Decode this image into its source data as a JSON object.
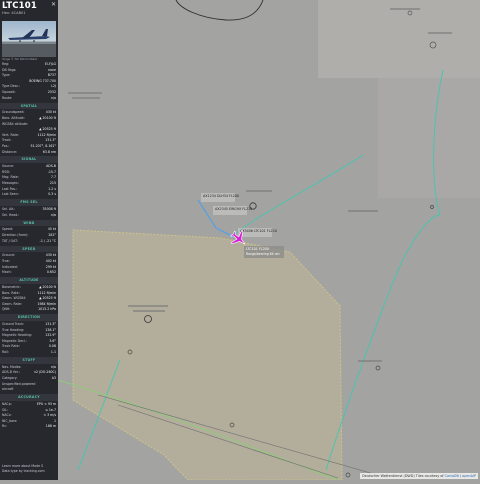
{
  "aircraft": {
    "callsign": "LTC101",
    "hex_line": "Hex: 4CAB01",
    "close": "✕",
    "photo_caption": "Image © Tim Patrick-Walsh"
  },
  "info_rows": [
    {
      "k": "Reg:",
      "v": "EI-FJLG"
    },
    {
      "k": "DB flags:",
      "v": "none"
    },
    {
      "k": "Type:",
      "v": "B737"
    },
    {
      "k": "",
      "v": "BOEING 737-700"
    },
    {
      "k": "Type Desc.:",
      "v": "L2J"
    },
    {
      "k": "Squawk:",
      "v": "2532"
    },
    {
      "k": "Route:",
      "v": "n/a"
    }
  ],
  "sections": {
    "spatial": "SPATIAL",
    "signal": "SIGNAL",
    "fms": "FMS SEL",
    "wind": "WIND",
    "speed": "SPEED",
    "altitude": "ALTITUDE",
    "direction": "DIRECTION",
    "stuff": "STUFF",
    "accuracy": "ACCURACY"
  },
  "spatial_rows": [
    {
      "k": "Groundspeed:",
      "v": "430 kt"
    },
    {
      "k": "Baro. Altitude:",
      "v": "▲ 20100 ft"
    },
    {
      "k": "WGS84 altitude:",
      "v": ""
    },
    {
      "k": "",
      "v": "▲ 20525 ft"
    },
    {
      "k": "Vert. Rate:",
      "v": "1112 ft/min"
    },
    {
      "k": "Track:",
      "v": "131.3°"
    },
    {
      "k": "Pos.:",
      "v": "51.207°, 8.161°"
    },
    {
      "k": "Distance:",
      "v": "63.8 nm"
    }
  ],
  "signal_rows": [
    {
      "k": "Source:",
      "v": "ADS-B"
    },
    {
      "k": "RSSI:",
      "v": "-15.7"
    },
    {
      "k": "Msg. Rate:",
      "v": "7.7"
    },
    {
      "k": "Messages:",
      "v": "215"
    },
    {
      "k": "Last Pos.:",
      "v": "1.2 s"
    },
    {
      "k": "Last Seen:",
      "v": "0.3 s"
    }
  ],
  "fms_rows": [
    {
      "k": "Sel. Alt.:",
      "v": "35008 ft"
    },
    {
      "k": "Sel. Head.:",
      "v": "n/a"
    }
  ],
  "wind_rows": [
    {
      "k": "Speed:",
      "v": "45 kt"
    },
    {
      "k": "Direction (from):",
      "v": "281°"
    },
    {
      "k": "TAT / OAT:",
      "v": "-1 / -21 °C"
    }
  ],
  "speed_rows": [
    {
      "k": "Ground:",
      "v": "430 kt"
    },
    {
      "k": "True:",
      "v": "402 kt"
    },
    {
      "k": "Indicated:",
      "v": "299 kt"
    },
    {
      "k": "Mach:",
      "v": "0.652"
    }
  ],
  "altitude_rows": [
    {
      "k": "Barometric:",
      "v": "▲ 20100 ft"
    },
    {
      "k": "Baro. Rate:",
      "v": "1112 ft/min"
    },
    {
      "k": "Geom. WGS84:",
      "v": "▲ 20525 ft"
    },
    {
      "k": "Geom. Rate:",
      "v": "1984 ft/min"
    },
    {
      "k": "QNH:",
      "v": "1013.2 hPa"
    }
  ],
  "direction_rows": [
    {
      "k": "Ground Track:",
      "v": "131.3°"
    },
    {
      "k": "True Heading:",
      "v": "138.1°"
    },
    {
      "k": "Magnetic Heading:",
      "v": "132.9°"
    },
    {
      "k": "Magnetic Decl.:",
      "v": "3.6°"
    },
    {
      "k": "Track Rate:",
      "v": "0.06"
    },
    {
      "k": "Roll:",
      "v": "1.1"
    }
  ],
  "stuff_rows": [
    {
      "k": "Nav. Modes:",
      "v": "n/a"
    },
    {
      "k": "ADS-B Ver.:",
      "v": "v2 (DO-260C)"
    },
    {
      "k": "Category:",
      "v": "A3"
    },
    {
      "k": "Unspecified powered",
      "v": ""
    },
    {
      "k": "aircraft",
      "v": ""
    }
  ],
  "accuracy_rows": [
    {
      "k": "NACp:",
      "v": "EPU < 93 m"
    },
    {
      "k": "SIL:",
      "v": "≤ 1e-7"
    },
    {
      "k": "NACv:",
      "v": "< 3 m/s"
    },
    {
      "k": "NIC_baro:",
      "v": "1"
    },
    {
      "k": "Rc:",
      "v": "186 m"
    }
  ],
  "footer": {
    "line1": "Learn more about Mode S",
    "line2": "Data type by tracking.com"
  },
  "map": {
    "attribution_pre": "Deutscher Wetterdienst (DWD) Tiles courtesy of ",
    "attribution_link1": "CartoDB",
    "attribution_mid": " / ",
    "attribution_link2": "openAIP",
    "flight_label_1": "AX1234 DLH34 FL200",
    "flight_label_2": "AX2345 EWG9X FL210",
    "flight_label_3": "AX3456 LTC101 FL220",
    "selected_label": "LTC101 FL200",
    "selected_box": "Range/bearing 64 nm",
    "accent_track": "#45c4b0",
    "selected_color": "#d61fd6"
  }
}
